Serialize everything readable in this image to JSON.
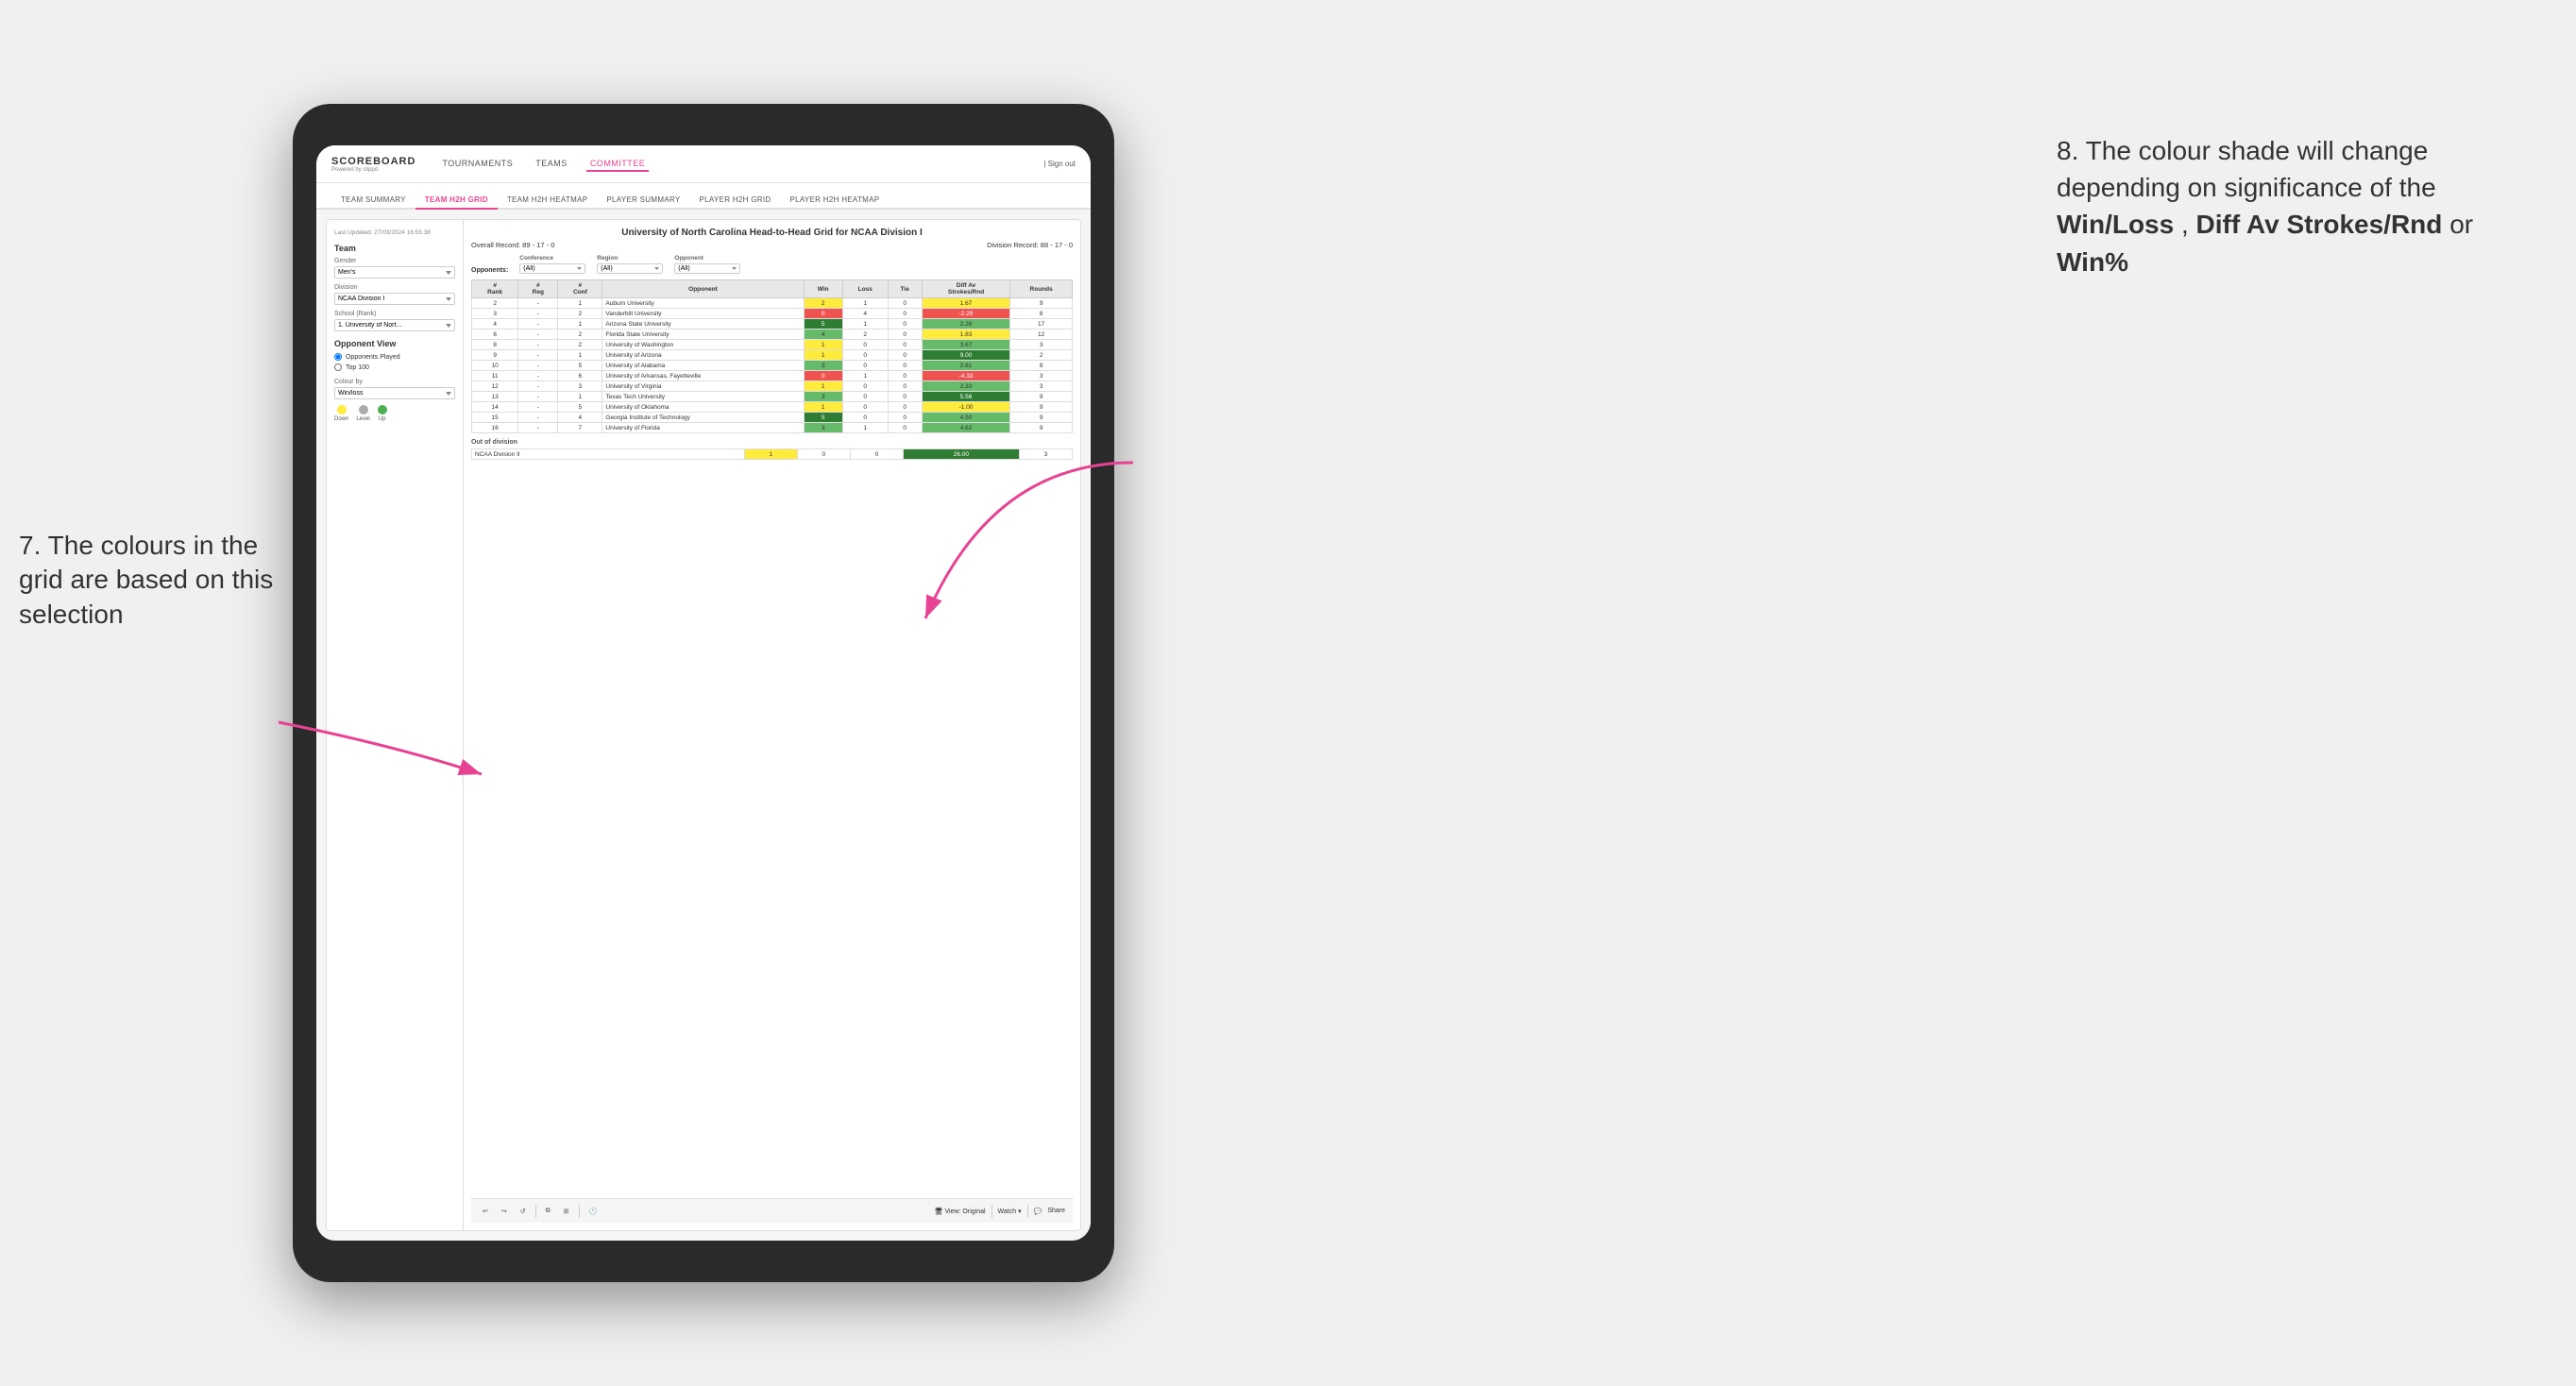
{
  "annotations": {
    "left": {
      "number": "7.",
      "text": "The colours in the grid are based on this selection"
    },
    "right": {
      "number": "8.",
      "text": "The colour shade will change depending on significance of the ",
      "bold1": "Win/Loss",
      "sep1": ", ",
      "bold2": "Diff Av Strokes/Rnd",
      "sep2": " or ",
      "bold3": "Win%"
    }
  },
  "header": {
    "logo": "SCOREBOARD",
    "logo_sub": "Powered by clippd",
    "nav": [
      "TOURNAMENTS",
      "TEAMS",
      "COMMITTEE"
    ],
    "active_nav": "COMMITTEE",
    "sign_out": "Sign out"
  },
  "subnav": {
    "items": [
      "TEAM SUMMARY",
      "TEAM H2H GRID",
      "TEAM H2H HEATMAP",
      "PLAYER SUMMARY",
      "PLAYER H2H GRID",
      "PLAYER H2H HEATMAP"
    ],
    "active": "TEAM H2H GRID"
  },
  "sidebar": {
    "timestamp": "Last Updated: 27/03/2024 16:55:38",
    "team_label": "Team",
    "gender_label": "Gender",
    "gender_value": "Men's",
    "division_label": "Division",
    "division_value": "NCAA Division I",
    "school_label": "School (Rank)",
    "school_value": "1. University of Nort...",
    "opponent_view_label": "Opponent View",
    "radio_options": [
      "Opponents Played",
      "Top 100"
    ],
    "radio_selected": "Opponents Played",
    "colour_by_label": "Colour by",
    "colour_by_value": "Win/loss",
    "legend": {
      "down": "Down",
      "level": "Level",
      "up": "Up"
    }
  },
  "grid": {
    "title": "University of North Carolina Head-to-Head Grid for NCAA Division I",
    "overall_record": "Overall Record: 89 - 17 - 0",
    "division_record": "Division Record: 88 - 17 - 0",
    "filters": {
      "conference_label": "Conference",
      "conference_value": "(All)",
      "region_label": "Region",
      "region_value": "(All)",
      "opponent_label": "Opponent",
      "opponent_value": "(All)",
      "opponents_label": "Opponents:"
    },
    "columns": [
      "#\nRank",
      "#\nReg",
      "#\nConf",
      "Opponent",
      "Win",
      "Loss",
      "Tie",
      "Diff Av\nStrokes/Rnd",
      "Rounds"
    ],
    "rows": [
      {
        "rank": "2",
        "reg": "-",
        "conf": "1",
        "opponent": "Auburn University",
        "win": "2",
        "loss": "1",
        "tie": "0",
        "diff": "1.67",
        "rounds": "9",
        "win_color": "yellow",
        "diff_color": "yellow"
      },
      {
        "rank": "3",
        "reg": "-",
        "conf": "2",
        "opponent": "Vanderbilt University",
        "win": "0",
        "loss": "4",
        "tie": "0",
        "diff": "-2.29",
        "rounds": "8",
        "win_color": "red",
        "diff_color": "red"
      },
      {
        "rank": "4",
        "reg": "-",
        "conf": "1",
        "opponent": "Arizona State University",
        "win": "5",
        "loss": "1",
        "tie": "0",
        "diff": "2.28",
        "rounds": "17",
        "win_color": "green-dark",
        "diff_color": "green"
      },
      {
        "rank": "6",
        "reg": "-",
        "conf": "2",
        "opponent": "Florida State University",
        "win": "4",
        "loss": "2",
        "tie": "0",
        "diff": "1.83",
        "rounds": "12",
        "win_color": "green",
        "diff_color": "yellow"
      },
      {
        "rank": "8",
        "reg": "-",
        "conf": "2",
        "opponent": "University of Washington",
        "win": "1",
        "loss": "0",
        "tie": "0",
        "diff": "3.67",
        "rounds": "3",
        "win_color": "yellow",
        "diff_color": "green"
      },
      {
        "rank": "9",
        "reg": "-",
        "conf": "1",
        "opponent": "University of Arizona",
        "win": "1",
        "loss": "0",
        "tie": "0",
        "diff": "9.00",
        "rounds": "2",
        "win_color": "yellow",
        "diff_color": "green-dark"
      },
      {
        "rank": "10",
        "reg": "-",
        "conf": "5",
        "opponent": "University of Alabama",
        "win": "3",
        "loss": "0",
        "tie": "0",
        "diff": "2.61",
        "rounds": "8",
        "win_color": "green",
        "diff_color": "green"
      },
      {
        "rank": "11",
        "reg": "-",
        "conf": "6",
        "opponent": "University of Arkansas, Fayetteville",
        "win": "0",
        "loss": "1",
        "tie": "0",
        "diff": "-4.33",
        "rounds": "3",
        "win_color": "red",
        "diff_color": "red"
      },
      {
        "rank": "12",
        "reg": "-",
        "conf": "3",
        "opponent": "University of Virginia",
        "win": "1",
        "loss": "0",
        "tie": "0",
        "diff": "2.33",
        "rounds": "3",
        "win_color": "yellow",
        "diff_color": "green"
      },
      {
        "rank": "13",
        "reg": "-",
        "conf": "1",
        "opponent": "Texas Tech University",
        "win": "3",
        "loss": "0",
        "tie": "0",
        "diff": "5.56",
        "rounds": "9",
        "win_color": "green",
        "diff_color": "green-dark"
      },
      {
        "rank": "14",
        "reg": "-",
        "conf": "5",
        "opponent": "University of Oklahoma",
        "win": "1",
        "loss": "0",
        "tie": "0",
        "diff": "-1.00",
        "rounds": "9",
        "win_color": "yellow",
        "diff_color": "yellow"
      },
      {
        "rank": "15",
        "reg": "-",
        "conf": "4",
        "opponent": "Georgia Institute of Technology",
        "win": "5",
        "loss": "0",
        "tie": "0",
        "diff": "4.50",
        "rounds": "9",
        "win_color": "green-dark",
        "diff_color": "green"
      },
      {
        "rank": "16",
        "reg": "-",
        "conf": "7",
        "opponent": "University of Florida",
        "win": "3",
        "loss": "1",
        "tie": "0",
        "diff": "4.62",
        "rounds": "9",
        "win_color": "green",
        "diff_color": "green"
      }
    ],
    "out_of_division": {
      "label": "Out of division",
      "rows": [
        {
          "division": "NCAA Division II",
          "win": "1",
          "loss": "0",
          "tie": "0",
          "diff": "26.00",
          "rounds": "3",
          "win_color": "yellow",
          "diff_color": "green-dark"
        }
      ]
    }
  },
  "toolbar": {
    "view_label": "View: Original",
    "watch_label": "Watch ▾",
    "share_label": "Share"
  }
}
